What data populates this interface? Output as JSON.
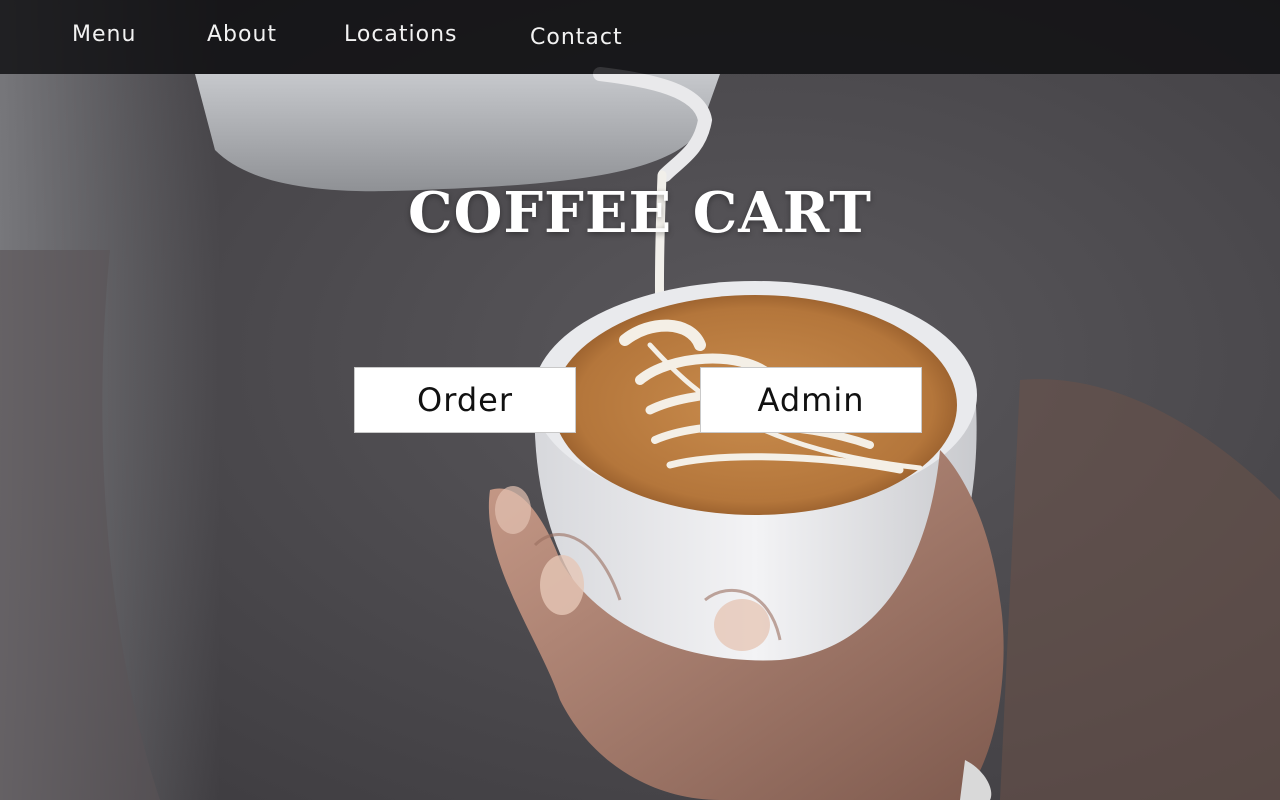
{
  "nav": {
    "menu_label": "Menu",
    "about_label": "About",
    "locations_label": "Locations",
    "contact_label": "Contact"
  },
  "hero": {
    "title": "COFFEE CART",
    "order_label": "Order",
    "admin_label": "Admin",
    "image_subject": "latte-art-pour"
  },
  "colors": {
    "navbar_bg": "#0e0d10",
    "button_bg": "#ffffff",
    "title_text": "#ffffff",
    "coffee_crema": "#b87a3e"
  }
}
